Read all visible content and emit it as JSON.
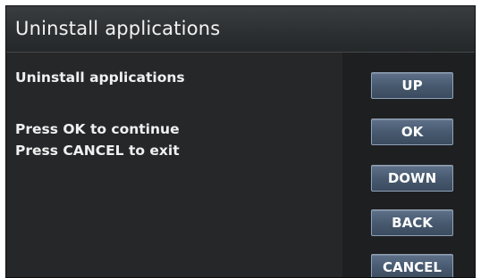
{
  "header": {
    "title": "Uninstall applications"
  },
  "message": {
    "heading": "Uninstall applications",
    "ok_prompt": "Press OK to continue",
    "cancel_prompt": "Press CANCEL to exit"
  },
  "buttons": {
    "up": "UP",
    "ok": "OK",
    "down": "DOWN",
    "back": "BACK",
    "cancel": "CANCEL"
  },
  "colors": {
    "screen_background": "#1b1c1d",
    "button_fill": "#485a70",
    "button_border": "#8fa1b7",
    "text": "#f0f0f0"
  }
}
